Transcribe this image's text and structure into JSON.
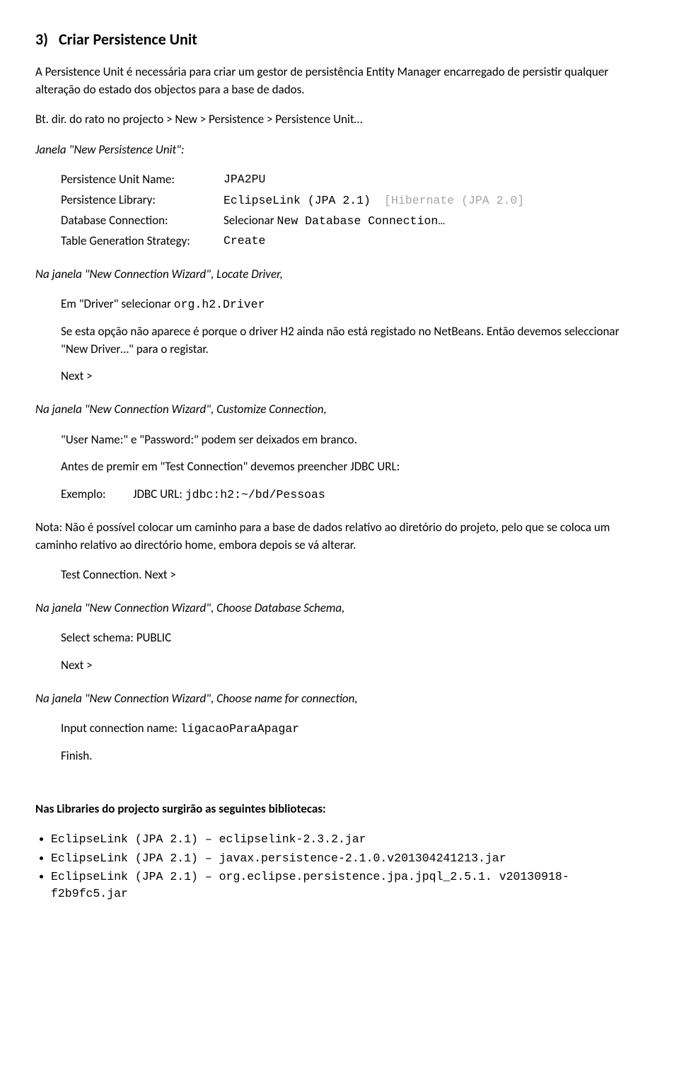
{
  "section": {
    "num": "3)",
    "title": "Criar Persistence Unit"
  },
  "intro": "A Persistence Unit é necessária para criar um gestor de persistência Entity Manager encarregado de persistir qualquer alteração do estado dos objectos para a base de dados.",
  "nav": "Bt. dir. do rato no projecto   >   New   >   Persistence   >   Persistence Unit…",
  "janela1": "Janela \"New Persistence Unit\":",
  "rows": {
    "puName": {
      "lab": "Persistence Unit Name:",
      "val": "JPA2PU"
    },
    "lib": {
      "lab": "Persistence Library:",
      "val": "EclipseLink (JPA 2.1)",
      "note": "[Hibernate (JPA 2.0]"
    },
    "db": {
      "lab": "Database Connection:",
      "pref": "Selecionar ",
      "val": "New Database Connection…"
    },
    "tgs": {
      "lab": "Table Generation Strategy:",
      "val": "Create"
    }
  },
  "locateTitle": "Na janela \"New Connection Wizard\", Locate Driver,",
  "locate": {
    "line1pre": "Em \"Driver\" selecionar ",
    "line1val": "org.h2.Driver",
    "line2": "Se esta opção não aparece é porque o driver H2 ainda não está registado no NetBeans. Então devemos seleccionar \"New Driver…\" para o registar.",
    "next": "Next >"
  },
  "customTitle": "Na janela \"New Connection Wizard\", Customize Connection,",
  "custom": {
    "line1": "\"User Name:\" e \"Password:\" podem ser deixados em branco.",
    "line2": "Antes de premir em \"Test Connection\" devemos preencher JDBC URL:",
    "exLabel": "Exemplo:",
    "exPre": "JDBC URL: ",
    "exVal": "jdbc:h2:~/bd/Pessoas"
  },
  "nota": "Nota: Não é possível colocar um caminho para a base de dados relativo ao diretório do projeto, pelo que se coloca um caminho relativo ao directório home, embora depois se vá alterar.",
  "testNext": "Test Connection. Next >",
  "schemaTitle": "Na janela \"New Connection Wizard\", Choose Database Schema,",
  "schema": {
    "line": "Select schema: PUBLIC",
    "next": "Next >"
  },
  "nameTitle": "Na janela \"New Connection Wizard\", Choose name for connection,",
  "name": {
    "pre": "Input connection name: ",
    "val": "ligacaoParaApagar",
    "finish": "Finish."
  },
  "libsTitle": "Nas Libraries do projecto surgirão as seguintes bibliotecas:",
  "libs": [
    "EclipseLink (JPA 2.1) – eclipselink-2.3.2.jar",
    "EclipseLink (JPA 2.1) – javax.persistence-2.1.0.v201304241213.jar",
    "EclipseLink (JPA 2.1) – org.eclipse.persistence.jpa.jpql_2.5.1. v20130918-f2b9fc5.jar"
  ]
}
